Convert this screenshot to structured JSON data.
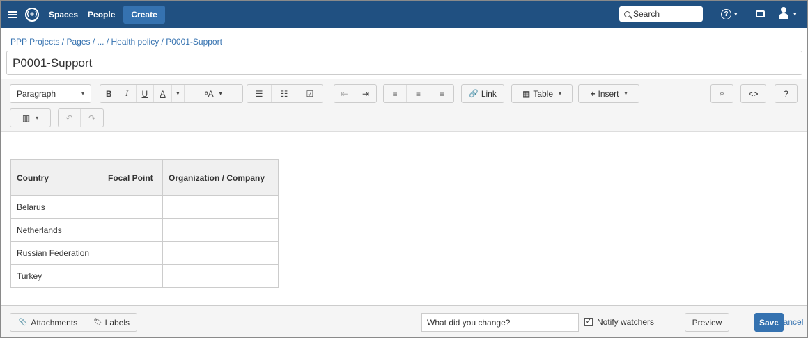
{
  "topbar": {
    "spaces": "Spaces",
    "people": "People",
    "create": "Create",
    "search_placeholder": "Search",
    "logo_text": "(+)",
    "help_icon_text": "?",
    "caret": "▾",
    "brand_color": "#205081"
  },
  "breadcrumb": "PPP Projects / Pages / ... / Health policy / P0001-Support",
  "page_title": "P0001-Support",
  "toolbar": {
    "paragraph": "Paragraph",
    "bold": "B",
    "italic": "I",
    "underline": "U",
    "text_color": "A",
    "format": "ᵃA",
    "bullet_list": "☰",
    "numbered_list": "☷",
    "task_list": "☑",
    "outdent": "⇤",
    "indent": "⇥",
    "align_left": "≡",
    "align_center": "≡",
    "align_right": "≡",
    "link": "Link",
    "table": "Table",
    "insert": "Insert",
    "find": "⌕",
    "source": "<>",
    "help": "?",
    "layout": "▥",
    "undo": "↶",
    "redo": "↷",
    "caret": "▾",
    "link_icon": "🔗",
    "table_icon": "▦",
    "insert_icon": "+"
  },
  "table": {
    "headers": [
      "Country",
      "Focal Point",
      "Organization / Company"
    ],
    "rows": [
      [
        "Belarus",
        "",
        ""
      ],
      [
        "Netherlands",
        "",
        ""
      ],
      [
        "Russian Federation",
        "",
        ""
      ],
      [
        "Turkey",
        "",
        ""
      ]
    ]
  },
  "footer": {
    "attachments": "Attachments",
    "labels": "Labels",
    "change_placeholder": "What did you change?",
    "notify_watchers": "Notify watchers",
    "notify_checked": true,
    "check_mark": "✓",
    "preview": "Preview",
    "save": "Save",
    "cancel": "Cancel",
    "attachment_icon": "📎",
    "label_icon": "🏷"
  }
}
